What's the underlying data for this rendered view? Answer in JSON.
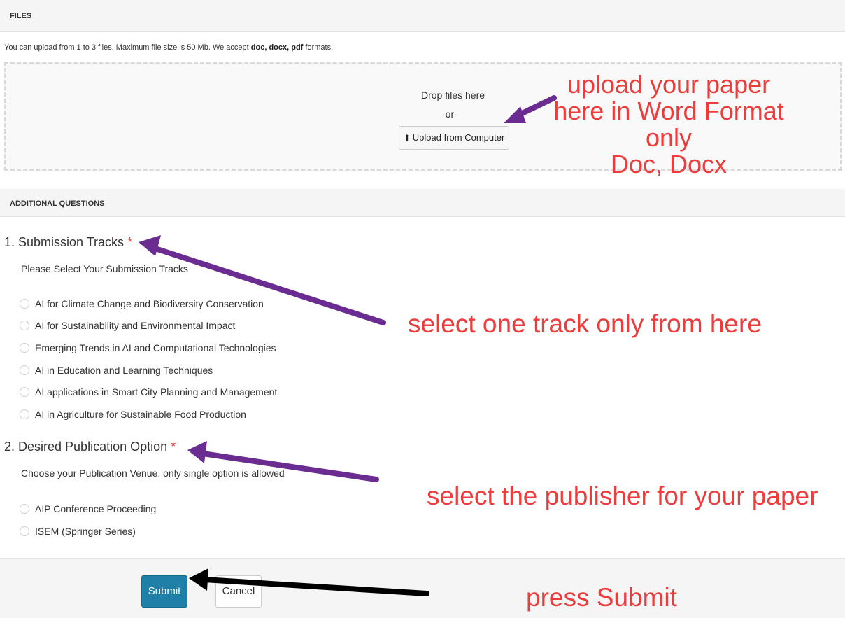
{
  "files": {
    "header": "FILES",
    "info_prefix": "You can upload from 1 to 3 files. Maximum file size is 50 Mb. We accept ",
    "info_formats": "doc, docx, pdf",
    "info_suffix": " formats.",
    "drop_text": "Drop files here",
    "or_text": "-or-",
    "upload_button": "Upload from Computer"
  },
  "additional_questions": {
    "header": "ADDITIONAL QUESTIONS",
    "questions": [
      {
        "title": "1. Submission Tracks",
        "required_mark": "*",
        "description": "Please Select Your Submission Tracks",
        "options": [
          "AI for Climate Change and Biodiversity Conservation",
          "AI for Sustainability and Environmental Impact",
          "Emerging Trends in AI and Computational Technologies",
          "AI in Education and Learning Techniques",
          "AI applications in Smart City Planning and Management",
          "AI in Agriculture for Sustainable Food Production"
        ]
      },
      {
        "title": "2. Desired Publication Option",
        "required_mark": "*",
        "description": "Choose your Publication Venue, only single option is allowed",
        "options": [
          "AIP Conference Proceeding",
          "ISEM (Springer Series)"
        ]
      }
    ]
  },
  "buttons": {
    "submit": "Submit",
    "cancel": "Cancel"
  },
  "annotations": {
    "upload": [
      "upload your paper",
      "here in Word Format",
      "only",
      "Doc, Docx"
    ],
    "track": "select one track only from here",
    "publisher": "select the publisher for your paper",
    "submit": "press Submit"
  },
  "colors": {
    "annotation_text": "#ee3b3b",
    "arrow_purple": "#6a2c91",
    "arrow_black": "#000000",
    "submit_button": "#1f7fa6",
    "required_mark": "#e53935"
  },
  "icons": {
    "upload": "circle-arrow-up-icon"
  }
}
